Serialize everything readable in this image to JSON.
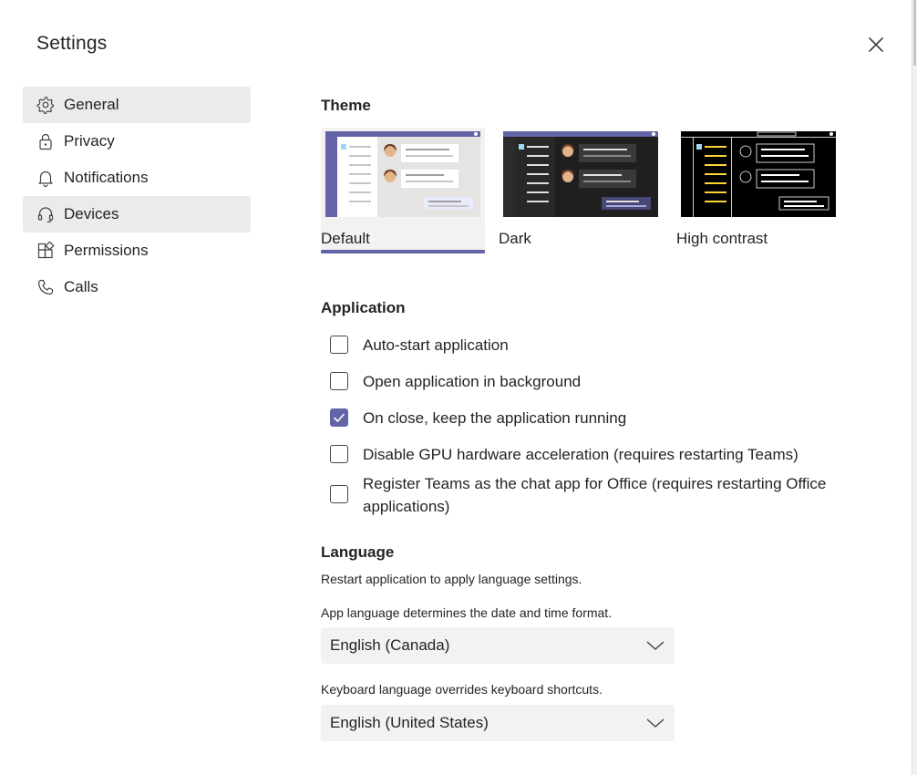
{
  "dialog": {
    "title": "Settings",
    "close_icon": "close-icon"
  },
  "sidebar": {
    "items": [
      {
        "label": "General",
        "icon": "gear-icon",
        "state": "selected"
      },
      {
        "label": "Privacy",
        "icon": "lock-icon",
        "state": "normal"
      },
      {
        "label": "Notifications",
        "icon": "bell-icon",
        "state": "normal"
      },
      {
        "label": "Devices",
        "icon": "headset-icon",
        "state": "hover"
      },
      {
        "label": "Permissions",
        "icon": "apps-icon",
        "state": "normal"
      },
      {
        "label": "Calls",
        "icon": "phone-icon",
        "state": "normal"
      }
    ]
  },
  "theme": {
    "heading": "Theme",
    "options": [
      {
        "label": "Default",
        "selected": true
      },
      {
        "label": "Dark",
        "selected": false
      },
      {
        "label": "High contrast",
        "selected": false
      }
    ]
  },
  "application": {
    "heading": "Application",
    "options": [
      {
        "label": "Auto-start application",
        "checked": false
      },
      {
        "label": "Open application in background",
        "checked": false
      },
      {
        "label": "On close, keep the application running",
        "checked": true
      },
      {
        "label": "Disable GPU hardware acceleration (requires restarting Teams)",
        "checked": false
      },
      {
        "label": "Register Teams as the chat app for Office (requires restarting Office applications)",
        "checked": false
      }
    ]
  },
  "language": {
    "heading": "Language",
    "restart_note": "Restart application to apply language settings.",
    "app_language_note": "App language determines the date and time format.",
    "app_language_value": "English (Canada)",
    "keyboard_language_note": "Keyboard language overrides keyboard shortcuts.",
    "keyboard_language_value": "English (United States)"
  },
  "colors": {
    "accent": "#6264a7",
    "selected_nav_bg": "#edebe9",
    "dropdown_bg": "#f3f2f1"
  }
}
